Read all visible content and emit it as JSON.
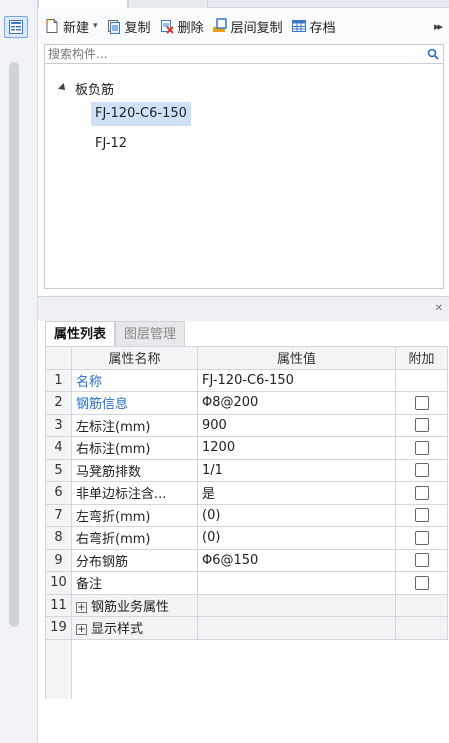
{
  "toolbar": {
    "new_label": "新建",
    "copy_label": "复制",
    "delete_label": "删除",
    "floor_copy_label": "层间复制",
    "save_label": "存档"
  },
  "search": {
    "placeholder": "搜索构件..."
  },
  "tree": {
    "root_label": "板负筋",
    "items": [
      "FJ-120-C6-150",
      "FJ-12"
    ],
    "selected": "FJ-120-C6-150"
  },
  "prop_panel": {
    "tabs": [
      "属性列表",
      "图层管理"
    ],
    "headers": {
      "name": "属性名称",
      "value": "属性值",
      "extra": "附加"
    },
    "rows": [
      {
        "idx": "1",
        "name": "名称",
        "value": "FJ-120-C6-150",
        "link": true,
        "checkbox": false
      },
      {
        "idx": "2",
        "name": "钢筋信息",
        "value": "Φ8@200",
        "link": true,
        "checkbox": true
      },
      {
        "idx": "3",
        "name": "左标注(mm)",
        "value": "900",
        "link": false,
        "checkbox": true
      },
      {
        "idx": "4",
        "name": "右标注(mm)",
        "value": "1200",
        "link": false,
        "checkbox": true
      },
      {
        "idx": "5",
        "name": "马凳筋排数",
        "value": "1/1",
        "link": false,
        "checkbox": true
      },
      {
        "idx": "6",
        "name": "非单边标注含...",
        "value": "是",
        "link": false,
        "checkbox": true
      },
      {
        "idx": "7",
        "name": "左弯折(mm)",
        "value": "(0)",
        "link": false,
        "checkbox": true
      },
      {
        "idx": "8",
        "name": "右弯折(mm)",
        "value": "(0)",
        "link": false,
        "checkbox": true
      },
      {
        "idx": "9",
        "name": "分布钢筋",
        "value": "Φ6@150",
        "link": false,
        "checkbox": true
      },
      {
        "idx": "10",
        "name": "备注",
        "value": "",
        "link": false,
        "checkbox": true
      }
    ],
    "groups": [
      {
        "idx": "11",
        "name": "钢筋业务属性"
      },
      {
        "idx": "19",
        "name": "显示样式"
      }
    ]
  }
}
